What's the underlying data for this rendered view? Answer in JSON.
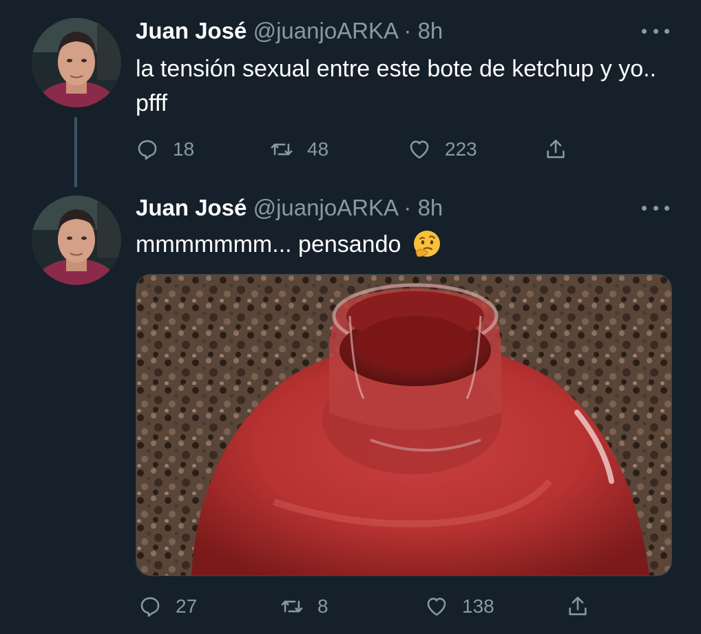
{
  "tweets": [
    {
      "author_name": "Juan José",
      "handle": "@juanjoARKA",
      "separator": "·",
      "time": "8h",
      "text": "la tensión sexual entre este bote de ketchup y yo.. pfff",
      "replies": "18",
      "retweets": "48",
      "likes": "223"
    },
    {
      "author_name": "Juan José",
      "handle": "@juanjoARKA",
      "separator": "·",
      "time": "8h",
      "text": "mmmmmmm... pensando",
      "emoji": "thinking-face",
      "replies": "27",
      "retweets": "8",
      "likes": "138"
    }
  ],
  "icons": {
    "reply": "reply-icon",
    "retweet": "retweet-icon",
    "like": "heart-icon",
    "share": "share-icon",
    "more": "more-icon"
  },
  "colors": {
    "background": "#15202b",
    "secondary_text": "#8899a6",
    "primary_text": "#ffffff",
    "thread_line": "#3d5466"
  }
}
